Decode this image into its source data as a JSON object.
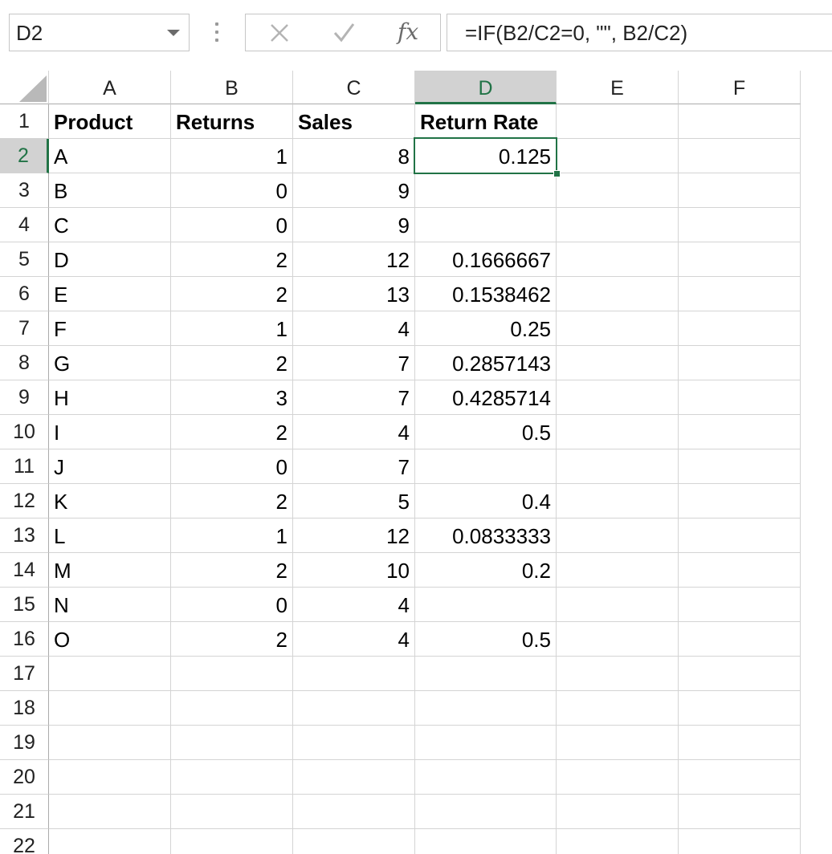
{
  "name_box": {
    "value": "D2"
  },
  "formula_bar": {
    "formula": "=IF(B2/C2=0, \"\", B2/C2)",
    "fx_label": "fx"
  },
  "columns": [
    "A",
    "B",
    "C",
    "D",
    "E",
    "F"
  ],
  "selected_column": "D",
  "selected_row": "2",
  "rows": [
    {
      "row": "1",
      "cells": [
        "Product",
        "Returns",
        "Sales",
        "Return Rate",
        "",
        ""
      ]
    },
    {
      "row": "2",
      "cells": [
        "A",
        "1",
        "8",
        "0.125",
        "",
        ""
      ]
    },
    {
      "row": "3",
      "cells": [
        "B",
        "0",
        "9",
        "",
        "",
        ""
      ]
    },
    {
      "row": "4",
      "cells": [
        "C",
        "0",
        "9",
        "",
        "",
        ""
      ]
    },
    {
      "row": "5",
      "cells": [
        "D",
        "2",
        "12",
        "0.1666667",
        "",
        ""
      ]
    },
    {
      "row": "6",
      "cells": [
        "E",
        "2",
        "13",
        "0.1538462",
        "",
        ""
      ]
    },
    {
      "row": "7",
      "cells": [
        "F",
        "1",
        "4",
        "0.25",
        "",
        ""
      ]
    },
    {
      "row": "8",
      "cells": [
        "G",
        "2",
        "7",
        "0.2857143",
        "",
        ""
      ]
    },
    {
      "row": "9",
      "cells": [
        "H",
        "3",
        "7",
        "0.4285714",
        "",
        ""
      ]
    },
    {
      "row": "10",
      "cells": [
        "I",
        "2",
        "4",
        "0.5",
        "",
        ""
      ]
    },
    {
      "row": "11",
      "cells": [
        "J",
        "0",
        "7",
        "",
        "",
        ""
      ]
    },
    {
      "row": "12",
      "cells": [
        "K",
        "2",
        "5",
        "0.4",
        "",
        ""
      ]
    },
    {
      "row": "13",
      "cells": [
        "L",
        "1",
        "12",
        "0.0833333",
        "",
        ""
      ]
    },
    {
      "row": "14",
      "cells": [
        "M",
        "2",
        "10",
        "0.2",
        "",
        ""
      ]
    },
    {
      "row": "15",
      "cells": [
        "N",
        "0",
        "4",
        "",
        "",
        ""
      ]
    },
    {
      "row": "16",
      "cells": [
        "O",
        "2",
        "4",
        "0.5",
        "",
        ""
      ]
    },
    {
      "row": "17",
      "cells": [
        "",
        "",
        "",
        "",
        "",
        ""
      ]
    },
    {
      "row": "18",
      "cells": [
        "",
        "",
        "",
        "",
        "",
        ""
      ]
    },
    {
      "row": "19",
      "cells": [
        "",
        "",
        "",
        "",
        "",
        ""
      ]
    },
    {
      "row": "20",
      "cells": [
        "",
        "",
        "",
        "",
        "",
        ""
      ]
    },
    {
      "row": "21",
      "cells": [
        "",
        "",
        "",
        "",
        "",
        ""
      ]
    },
    {
      "row": "22",
      "cells": [
        "",
        "",
        "",
        "",
        "",
        ""
      ]
    }
  ],
  "colors": {
    "accent": "#217346",
    "gridline": "#d4d4d4",
    "header_selected_bg": "#d2d2d2"
  }
}
